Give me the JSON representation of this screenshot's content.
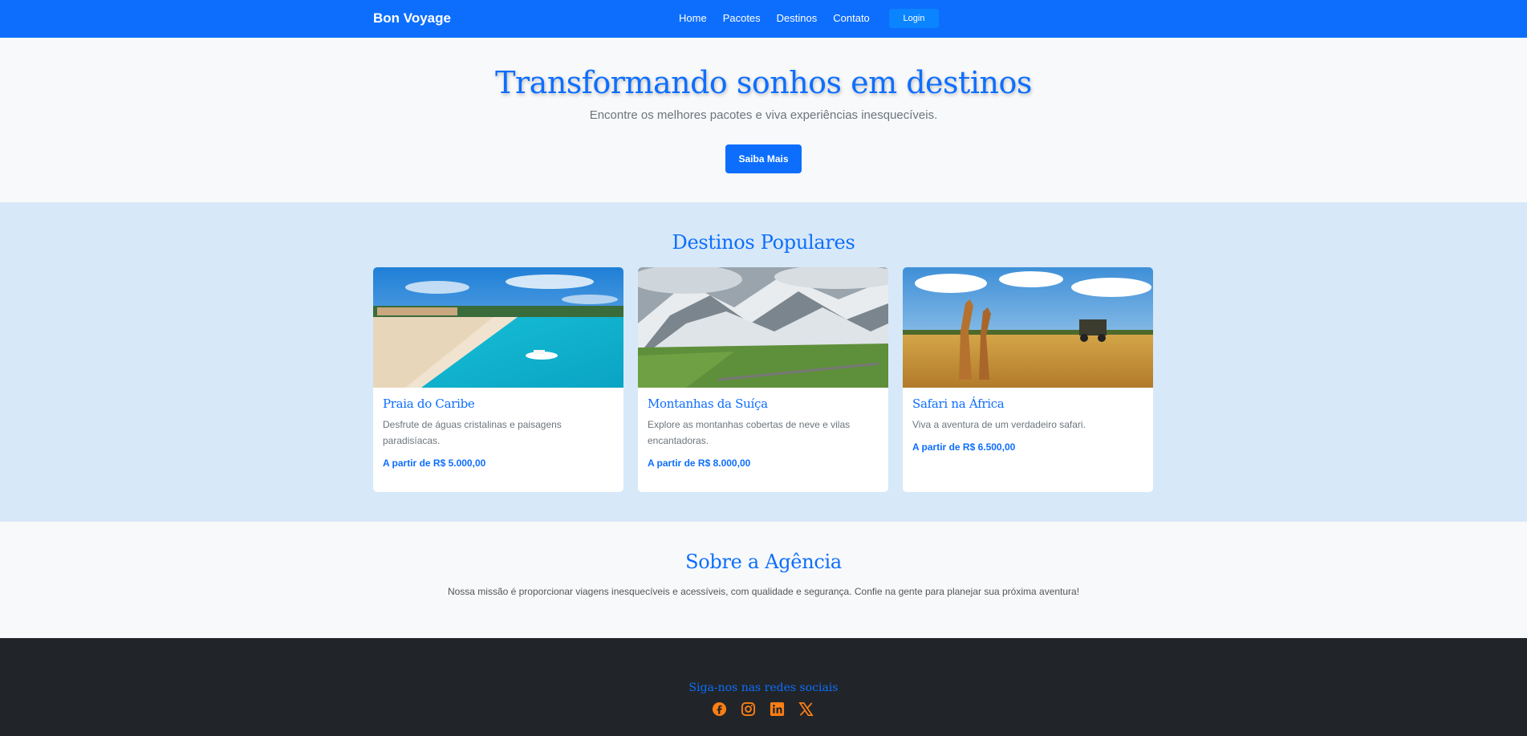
{
  "navbar": {
    "brand": "Bon Voyage",
    "links": [
      "Home",
      "Pacotes",
      "Destinos",
      "Contato"
    ],
    "login": "Login"
  },
  "hero": {
    "title": "Transformando sonhos em destinos",
    "subtitle": "Encontre os melhores pacotes e viva experiências inesquecíveis.",
    "cta": "Saiba Mais"
  },
  "destinos": {
    "heading": "Destinos Populares",
    "cards": [
      {
        "title": "Praia do Caribe",
        "description": "Desfrute de águas cristalinas e paisagens paradisíacas.",
        "price": "A partir de R$ 5.000,00",
        "image_icon": "beach-image"
      },
      {
        "title": "Montanhas da Suíça",
        "description": "Explore as montanhas cobertas de neve e vilas encantadoras.",
        "price": "A partir de R$ 8.000,00",
        "image_icon": "mountain-image"
      },
      {
        "title": "Safari na África",
        "description": "Viva a aventura de um verdadeiro safari.",
        "price": "A partir de R$ 6.500,00",
        "image_icon": "safari-image"
      }
    ]
  },
  "sobre": {
    "heading": "Sobre a Agência",
    "text": "Nossa missão é proporcionar viagens inesquecíveis e acessíveis, com qualidade e segurança. Confie na gente para planejar sua próxima aventura!"
  },
  "footer": {
    "follow": "Siga-nos nas redes sociais",
    "socials": [
      "facebook-icon",
      "instagram-icon",
      "linkedin-icon",
      "x-icon"
    ],
    "icon_color": "#fd7e14"
  },
  "colors": {
    "primary": "#0d6efd",
    "section_bg": "#d7e8f8",
    "footer_bg": "#212529"
  }
}
